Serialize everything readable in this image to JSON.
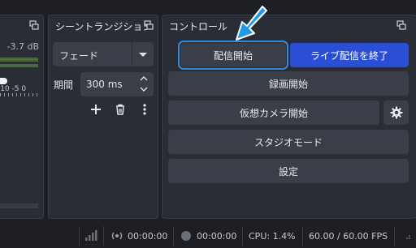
{
  "mixer": {
    "db_value": "-3.7 dB",
    "scale_text": "-10 -5 0"
  },
  "transitions": {
    "title": "シーントランジション",
    "transition_select": "フェード",
    "duration_label": "期間",
    "duration_value": "300 ms"
  },
  "controls": {
    "title": "コントロール",
    "start_streaming": "配信開始",
    "stop_live": "ライブ配信を終了",
    "start_recording": "録画開始",
    "start_virtual_camera": "仮想カメラ開始",
    "studio_mode": "スタジオモード",
    "settings": "設定"
  },
  "status": {
    "stream_time": "00:00:00",
    "record_time": "00:00:00",
    "cpu": "CPU: 1.4%",
    "fps": "60.00 / 60.00 FPS"
  },
  "colors": {
    "accent": "#2a4fd6",
    "highlight_outline": "#2e8be0",
    "annotation_arrow": "#1e9be8"
  }
}
